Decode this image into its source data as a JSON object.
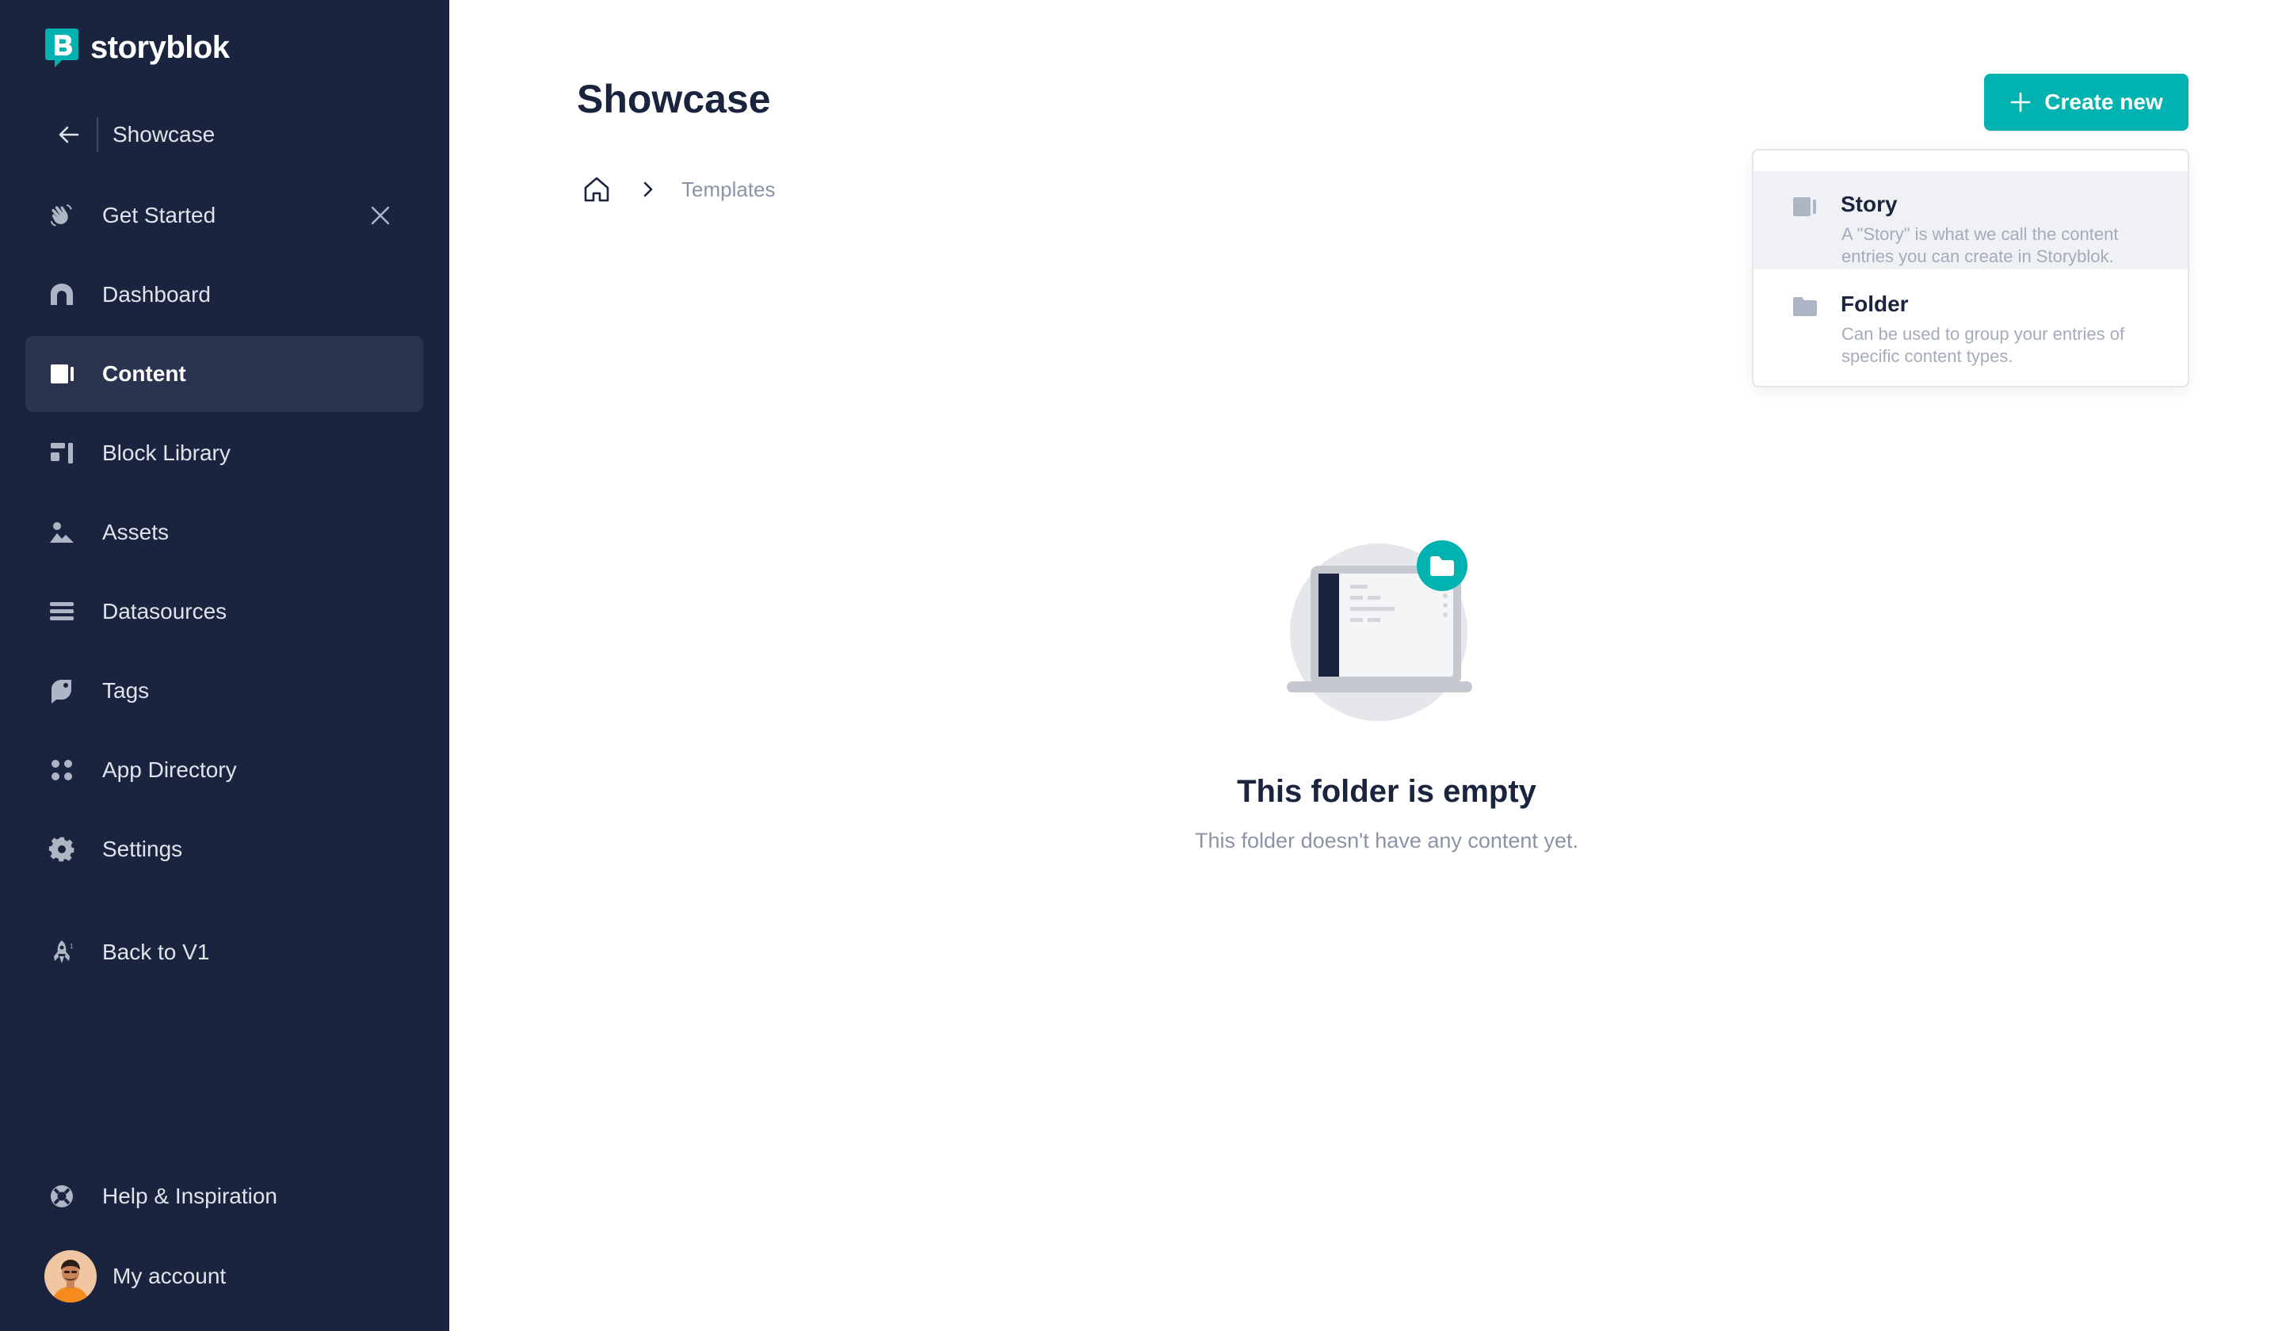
{
  "app": {
    "brand": "storyblok",
    "accent_color": "#00b3b0",
    "sidebar_color": "#1b243f"
  },
  "sidebar": {
    "space_name": "Showcase",
    "items": [
      {
        "label": "Get Started",
        "icon": "hand-wave-icon"
      },
      {
        "label": "Dashboard",
        "icon": "dashboard-icon"
      },
      {
        "label": "Content",
        "icon": "content-icon",
        "active": true
      },
      {
        "label": "Block Library",
        "icon": "blocks-icon"
      },
      {
        "label": "Assets",
        "icon": "assets-icon"
      },
      {
        "label": "Datasources",
        "icon": "datasources-icon"
      },
      {
        "label": "Tags",
        "icon": "tag-icon"
      },
      {
        "label": "App Directory",
        "icon": "apps-icon"
      },
      {
        "label": "Settings",
        "icon": "gear-icon"
      },
      {
        "label": "Back to V1",
        "icon": "rocket-icon"
      }
    ],
    "help_label": "Help & Inspiration",
    "account_label": "My account"
  },
  "main": {
    "title": "Showcase",
    "breadcrumb": {
      "current": "Templates"
    },
    "create_button": "Create new",
    "dropdown": [
      {
        "title": "Story",
        "description": "A \"Story\" is what we call the content entries you can create in Storyblok.",
        "icon": "story-icon"
      },
      {
        "title": "Folder",
        "description": "Can be used to group your entries of specific content types.",
        "icon": "folder-icon"
      }
    ],
    "empty_state": {
      "title": "This folder is empty",
      "subtitle": "This folder doesn't have any content yet."
    }
  }
}
